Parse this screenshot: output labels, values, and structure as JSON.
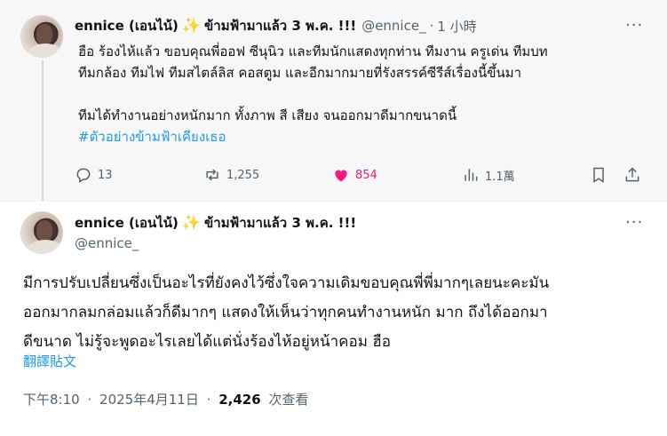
{
  "reply_post": {
    "author_name": "ennice (เอนไน้)",
    "sparkle": "✨",
    "author_suffix": "ข้ามฟ้ามาแล้ว 3 พ.ค. !!!",
    "handle": "@ennice_",
    "separator": "·",
    "time": "1 小時",
    "more": "···",
    "lines": [
      "ฮือ ร้องไห้แล้ว ขอบคุณพี่ออฟ  ซีนุนิว และทีมนักแสดงทุกท่าน ทีมงาน ครูเด่น ทีมบท",
      "ทีมกล้อง ทีมไฟ ทีมสไตล์ลิส คอสตูม และอีกมากมายที่รังสรรค์ซีรีส์เรื่องนี้ขึ้นมา",
      "",
      "ทีมได้ทำงานอย่างหนักมาก ทั้งภาพ สี เสียง จนออกมาดีมากขนาดนี้"
    ],
    "hashtag": "#ตัวอย่างข้ามฟ้าเคียงเธอ",
    "stats": {
      "replies": "13",
      "reposts": "1,255",
      "likes": "854",
      "views": "1.1萬"
    }
  },
  "main_post": {
    "author_name": "ennice (เอนไน้)",
    "sparkle": "✨",
    "author_suffix": "ข้ามฟ้ามาแล้ว 3 พ.ค. !!!",
    "handle": "@ennice_",
    "more": "···",
    "lines": [
      "มีการปรับเปลี่ยนซึ่งเป็นอะไรที่ยังคงไว้ซึ่งใจความเดิมขอบคุณพี่พี่มากๆเลยนะคะมัน",
      "ออกมากลมกล่อมแล้วก็ดีมากๆ  แสดงให้เห็นว่าทุกคนทำงานหนัก มาก ถึงได้ออกมา",
      "ดีขนาด  ไม่รู้จะพูดอะไรเลยได้แต่นั่งร้องไห้อยู่หน้าคอม ฮือ"
    ],
    "translate": "翻譯貼文",
    "time": "下午8:10",
    "date": "2025年4月11日",
    "dot": "·",
    "views_count": "2,426",
    "views_label": "次查看"
  },
  "colors": {
    "accent": "#1d9bf0",
    "like": "#f91880",
    "muted": "#536471",
    "text": "#0f1419"
  },
  "icons": [
    "reply-icon",
    "repost-icon",
    "like-icon",
    "views-icon",
    "bookmark-icon",
    "share-icon",
    "sparkle-icon",
    "more-icon"
  ]
}
